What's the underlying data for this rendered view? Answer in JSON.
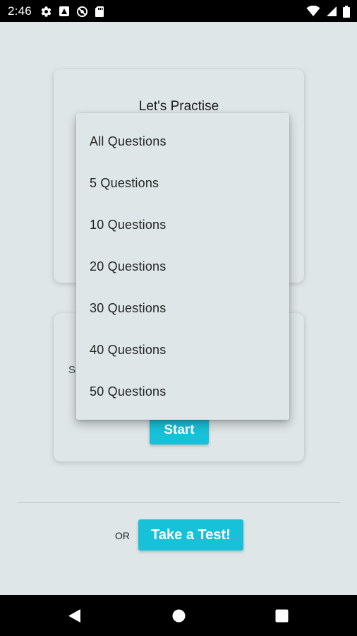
{
  "status_bar": {
    "time": "2:46",
    "left_icons": [
      "gear-icon",
      "contrast-app-icon",
      "sync-disabled-icon",
      "sd-card-icon"
    ],
    "right_icons": [
      "wifi-icon",
      "signal-icon",
      "battery-icon"
    ]
  },
  "practice_card": {
    "title": "Let's Practise"
  },
  "test_card": {
    "partial_label": "S",
    "start_label": "Start"
  },
  "dropdown": {
    "options": [
      "All Questions",
      "5 Questions",
      "10 Questions",
      "20 Questions",
      "30 Questions",
      "40 Questions",
      "50 Questions"
    ]
  },
  "bottom": {
    "or_label": "OR",
    "take_test_label": "Take a Test!"
  },
  "colors": {
    "background": "#dfe6e8",
    "accent": "#17c2d8"
  },
  "nav_bar": {
    "icons": [
      "back-icon",
      "home-icon",
      "recents-icon"
    ]
  }
}
